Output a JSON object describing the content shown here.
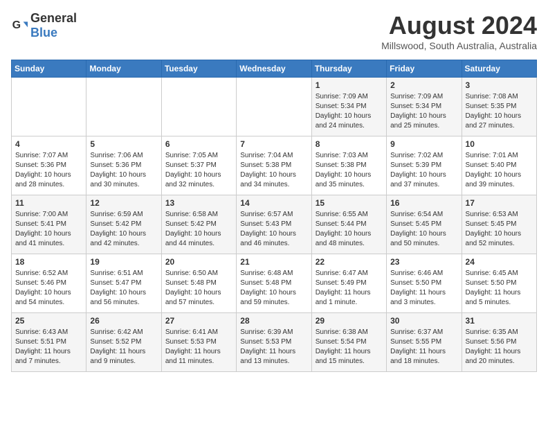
{
  "header": {
    "logo_general": "General",
    "logo_blue": "Blue",
    "title": "August 2024",
    "location": "Millswood, South Australia, Australia"
  },
  "weekdays": [
    "Sunday",
    "Monday",
    "Tuesday",
    "Wednesday",
    "Thursday",
    "Friday",
    "Saturday"
  ],
  "weeks": [
    [
      {
        "day": "",
        "text": ""
      },
      {
        "day": "",
        "text": ""
      },
      {
        "day": "",
        "text": ""
      },
      {
        "day": "",
        "text": ""
      },
      {
        "day": "1",
        "text": "Sunrise: 7:09 AM\nSunset: 5:34 PM\nDaylight: 10 hours\nand 24 minutes."
      },
      {
        "day": "2",
        "text": "Sunrise: 7:09 AM\nSunset: 5:34 PM\nDaylight: 10 hours\nand 25 minutes."
      },
      {
        "day": "3",
        "text": "Sunrise: 7:08 AM\nSunset: 5:35 PM\nDaylight: 10 hours\nand 27 minutes."
      }
    ],
    [
      {
        "day": "4",
        "text": "Sunrise: 7:07 AM\nSunset: 5:36 PM\nDaylight: 10 hours\nand 28 minutes."
      },
      {
        "day": "5",
        "text": "Sunrise: 7:06 AM\nSunset: 5:36 PM\nDaylight: 10 hours\nand 30 minutes."
      },
      {
        "day": "6",
        "text": "Sunrise: 7:05 AM\nSunset: 5:37 PM\nDaylight: 10 hours\nand 32 minutes."
      },
      {
        "day": "7",
        "text": "Sunrise: 7:04 AM\nSunset: 5:38 PM\nDaylight: 10 hours\nand 34 minutes."
      },
      {
        "day": "8",
        "text": "Sunrise: 7:03 AM\nSunset: 5:38 PM\nDaylight: 10 hours\nand 35 minutes."
      },
      {
        "day": "9",
        "text": "Sunrise: 7:02 AM\nSunset: 5:39 PM\nDaylight: 10 hours\nand 37 minutes."
      },
      {
        "day": "10",
        "text": "Sunrise: 7:01 AM\nSunset: 5:40 PM\nDaylight: 10 hours\nand 39 minutes."
      }
    ],
    [
      {
        "day": "11",
        "text": "Sunrise: 7:00 AM\nSunset: 5:41 PM\nDaylight: 10 hours\nand 41 minutes."
      },
      {
        "day": "12",
        "text": "Sunrise: 6:59 AM\nSunset: 5:42 PM\nDaylight: 10 hours\nand 42 minutes."
      },
      {
        "day": "13",
        "text": "Sunrise: 6:58 AM\nSunset: 5:42 PM\nDaylight: 10 hours\nand 44 minutes."
      },
      {
        "day": "14",
        "text": "Sunrise: 6:57 AM\nSunset: 5:43 PM\nDaylight: 10 hours\nand 46 minutes."
      },
      {
        "day": "15",
        "text": "Sunrise: 6:55 AM\nSunset: 5:44 PM\nDaylight: 10 hours\nand 48 minutes."
      },
      {
        "day": "16",
        "text": "Sunrise: 6:54 AM\nSunset: 5:45 PM\nDaylight: 10 hours\nand 50 minutes."
      },
      {
        "day": "17",
        "text": "Sunrise: 6:53 AM\nSunset: 5:45 PM\nDaylight: 10 hours\nand 52 minutes."
      }
    ],
    [
      {
        "day": "18",
        "text": "Sunrise: 6:52 AM\nSunset: 5:46 PM\nDaylight: 10 hours\nand 54 minutes."
      },
      {
        "day": "19",
        "text": "Sunrise: 6:51 AM\nSunset: 5:47 PM\nDaylight: 10 hours\nand 56 minutes."
      },
      {
        "day": "20",
        "text": "Sunrise: 6:50 AM\nSunset: 5:48 PM\nDaylight: 10 hours\nand 57 minutes."
      },
      {
        "day": "21",
        "text": "Sunrise: 6:48 AM\nSunset: 5:48 PM\nDaylight: 10 hours\nand 59 minutes."
      },
      {
        "day": "22",
        "text": "Sunrise: 6:47 AM\nSunset: 5:49 PM\nDaylight: 11 hours\nand 1 minute."
      },
      {
        "day": "23",
        "text": "Sunrise: 6:46 AM\nSunset: 5:50 PM\nDaylight: 11 hours\nand 3 minutes."
      },
      {
        "day": "24",
        "text": "Sunrise: 6:45 AM\nSunset: 5:50 PM\nDaylight: 11 hours\nand 5 minutes."
      }
    ],
    [
      {
        "day": "25",
        "text": "Sunrise: 6:43 AM\nSunset: 5:51 PM\nDaylight: 11 hours\nand 7 minutes."
      },
      {
        "day": "26",
        "text": "Sunrise: 6:42 AM\nSunset: 5:52 PM\nDaylight: 11 hours\nand 9 minutes."
      },
      {
        "day": "27",
        "text": "Sunrise: 6:41 AM\nSunset: 5:53 PM\nDaylight: 11 hours\nand 11 minutes."
      },
      {
        "day": "28",
        "text": "Sunrise: 6:39 AM\nSunset: 5:53 PM\nDaylight: 11 hours\nand 13 minutes."
      },
      {
        "day": "29",
        "text": "Sunrise: 6:38 AM\nSunset: 5:54 PM\nDaylight: 11 hours\nand 15 minutes."
      },
      {
        "day": "30",
        "text": "Sunrise: 6:37 AM\nSunset: 5:55 PM\nDaylight: 11 hours\nand 18 minutes."
      },
      {
        "day": "31",
        "text": "Sunrise: 6:35 AM\nSunset: 5:56 PM\nDaylight: 11 hours\nand 20 minutes."
      }
    ]
  ]
}
